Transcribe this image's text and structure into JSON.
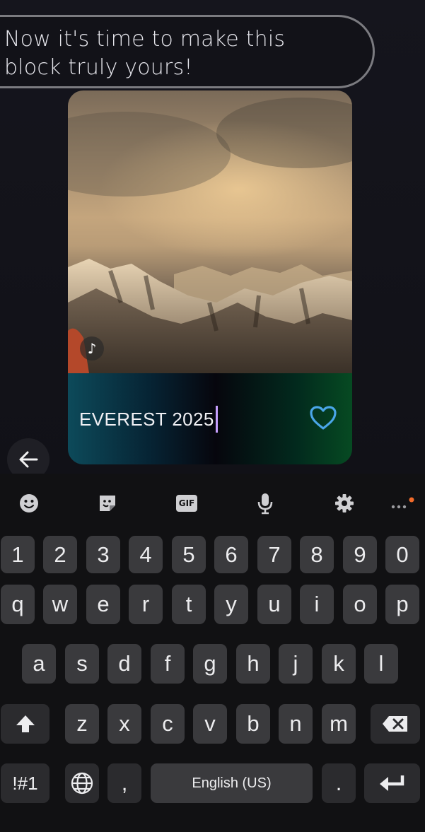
{
  "prompt": {
    "line1": "Now it's time to make this",
    "line2": "block truly yours!"
  },
  "card": {
    "title_value": "EVEREST 2025",
    "badge_icon": "tiktok-icon",
    "heart_icon": "heart-outline-icon",
    "heart_color": "#4aa6e8"
  },
  "navigation": {
    "back_icon": "arrow-left-icon"
  },
  "keyboard": {
    "toolbar": [
      "emoji-icon",
      "sticker-icon",
      "GIF",
      "microphone-icon",
      "settings-icon",
      "more-icon"
    ],
    "numbers": [
      "1",
      "2",
      "3",
      "4",
      "5",
      "6",
      "7",
      "8",
      "9",
      "0"
    ],
    "row1": [
      "q",
      "w",
      "e",
      "r",
      "t",
      "y",
      "u",
      "i",
      "o",
      "p"
    ],
    "row2": [
      "a",
      "s",
      "d",
      "f",
      "g",
      "h",
      "j",
      "k",
      "l"
    ],
    "row3": [
      "z",
      "x",
      "c",
      "v",
      "b",
      "n",
      "m"
    ],
    "symbols": "!#1",
    "comma": ",",
    "space": "English (US)",
    "period": ".",
    "accent_dot_color": "#f26b2a"
  }
}
